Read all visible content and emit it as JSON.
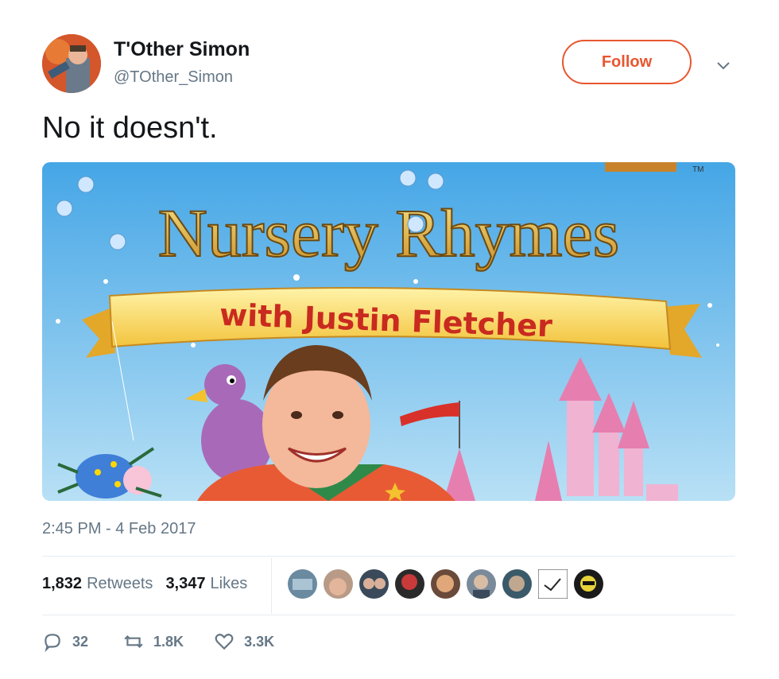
{
  "author": {
    "name": "T'Other Simon",
    "handle": "@TOther_Simon"
  },
  "follow_label": "Follow",
  "tweet_text": "No it doesn't.",
  "media": {
    "title_line": "Nursery Rhymes",
    "banner_text": "with Justin Fletcher",
    "trademark": "TM"
  },
  "timestamp": "2:45 PM - 4 Feb 2017",
  "stats": {
    "retweets_count": "1,832",
    "retweets_label": "Retweets",
    "likes_count": "3,347",
    "likes_label": "Likes"
  },
  "liker_avatars_count": 9,
  "actions": {
    "replies": "32",
    "retweets": "1.8K",
    "likes": "3.3K"
  },
  "colors": {
    "accent": "#e8562f",
    "muted": "#657786",
    "text": "#14171a"
  }
}
